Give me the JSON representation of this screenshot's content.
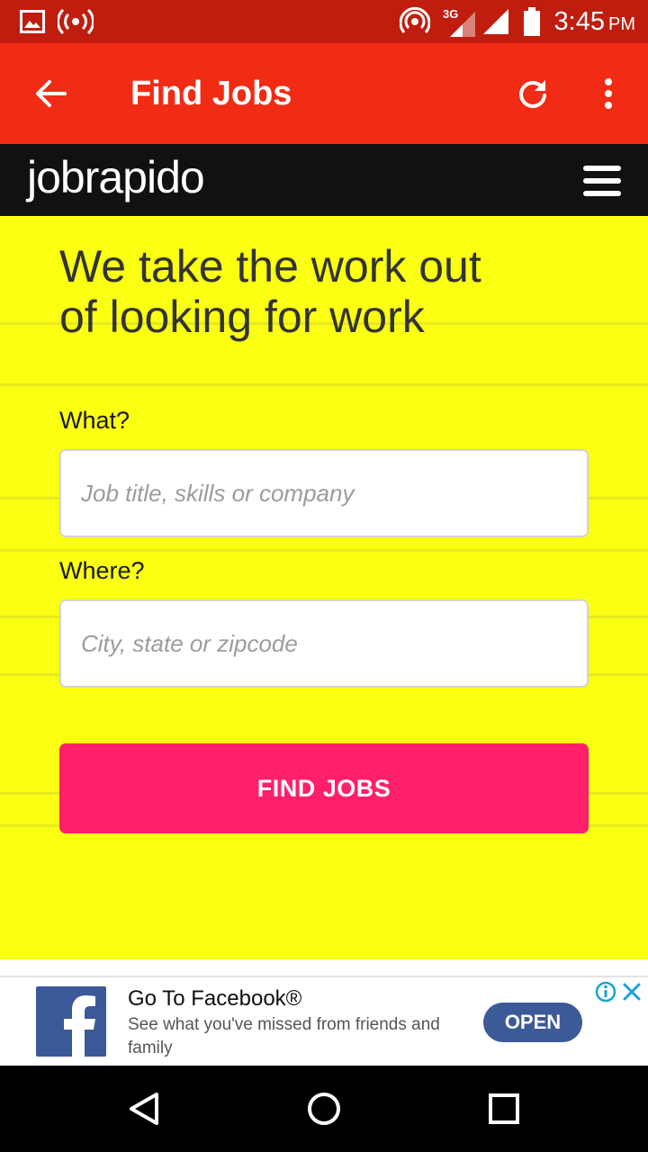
{
  "status_bar": {
    "time": "3:45",
    "ampm": "PM",
    "network": "3G",
    "icons": [
      "gallery-icon",
      "broadcast-icon",
      "hotspot-icon",
      "signal-3g-icon",
      "signal-icon",
      "battery-icon"
    ]
  },
  "app_bar": {
    "title": "Find Jobs",
    "icons": [
      "back-arrow-icon",
      "refresh-icon",
      "more-vert-icon"
    ]
  },
  "brand": {
    "logo": "jobrapido",
    "menu_icon": "hamburger-menu-icon"
  },
  "hero": {
    "headline_line1": "We take the work out",
    "headline_line2": "of looking for work",
    "what_label": "What?",
    "what_placeholder": "Job title, skills or company",
    "what_value": "",
    "where_label": "Where?",
    "where_placeholder": "City, state or zipcode",
    "where_value": "",
    "find_button": "FIND JOBS",
    "background_color": "#fbff12",
    "button_color": "#ff1f6a"
  },
  "ad": {
    "title": "Go To Facebook®",
    "description": "See what you've missed from friends and family",
    "open_button": "OPEN",
    "icons": [
      "facebook-logo-icon",
      "info-icon",
      "close-icon"
    ]
  },
  "nav_bar": {
    "icons": [
      "back-triangle-icon",
      "home-circle-icon",
      "recents-square-icon"
    ]
  },
  "colors": {
    "status_bar": "#c01d0f",
    "app_bar": "#f12b14",
    "brand_bar": "#111111",
    "facebook_blue": "#3b5998"
  }
}
